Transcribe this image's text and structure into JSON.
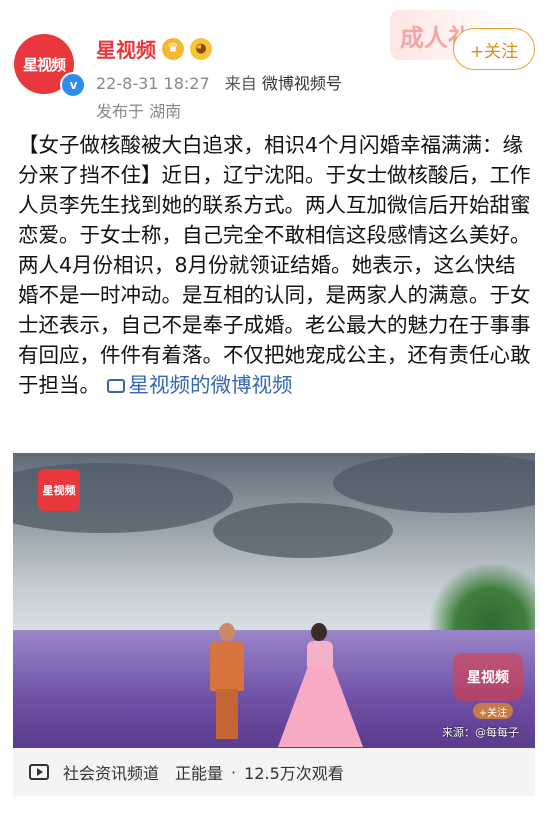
{
  "post": {
    "author": "星视频",
    "avatar_text": "星视频",
    "verified_mark": "v",
    "time": "22-8-31 18:27",
    "from_prefix": "来自",
    "from_source": "微博视频号",
    "location": "发布于 湖南",
    "follow_label": "+关注",
    "deco_text": "成人礼",
    "content": "【女子做核酸被大白追求，相识4个月闪婚幸福满满：缘分来了挡不住】近日，辽宁沈阳。于女士做核酸后，工作人员李先生找到她的联系方式。两人互加微信后开始甜蜜恋爱。于女士称，自己完全不敢相信这段感情这么美好。两人4月份相识，8月份就领证结婚。她表示，这么快结婚不是一时冲动。是互相的认同，是两家人的满意。于女士还表示，自己不是奉子成婚。老公最大的魅力在于事事有回应，件件有着落。不仅把她宠成公主，还有责任心敢于担当。",
    "content_link": "星视频的微博视频"
  },
  "video": {
    "logo_text": "星视频",
    "watermark_text": "星视频",
    "watermark_follow": "+关注",
    "source_text": "来源：@每每子"
  },
  "footer": {
    "channel": "社会资讯频道",
    "energy": "正能量",
    "views": "12.5万次观看"
  },
  "colors": {
    "accent": "#e8383d",
    "follow": "#e28a1c",
    "link": "#3567b4"
  }
}
